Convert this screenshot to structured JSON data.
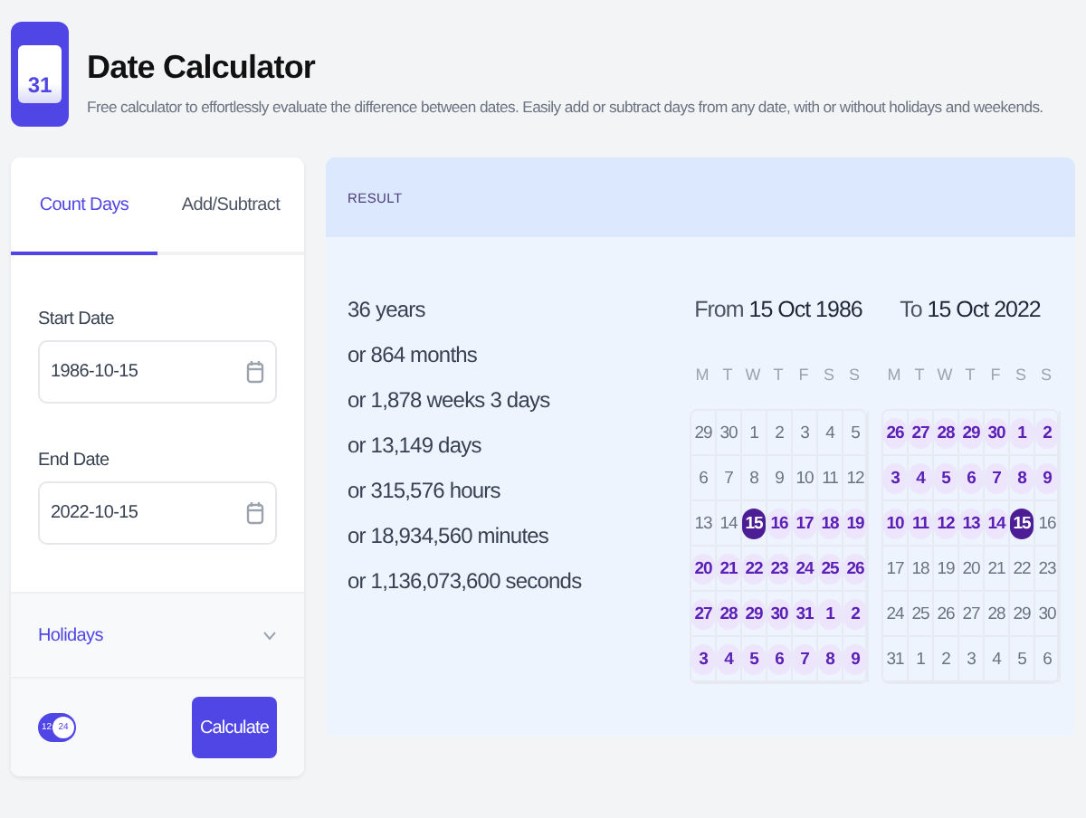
{
  "header": {
    "title": "Date Calculator",
    "subtitle": "Free calculator to effortlessly evaluate the difference between dates. Easily add or subtract days from any date, with or without holidays and weekends.",
    "icon_text": "31"
  },
  "form": {
    "tabs": [
      {
        "label": "Count Days",
        "selected": true
      },
      {
        "label": "Add/Subtract",
        "selected": false
      }
    ],
    "fields": [
      {
        "label": "Start Date",
        "value": "1986-10-15"
      },
      {
        "label": "End Date",
        "value": "2022-10-15"
      }
    ],
    "holidays": {
      "label": "Holidays",
      "expanded": false
    },
    "clock_toggle": {
      "labels": [
        "12",
        "24"
      ],
      "on": true
    },
    "button": "Calculate"
  },
  "result": {
    "heading": "RESULT",
    "lines": [
      "36 years",
      "or 864 months",
      "or 1,878 weeks 3 days",
      "or 13,149 days",
      "or 315,576 hours",
      "or 18,934,560 minutes",
      "or 1,136,073,600 seconds"
    ],
    "calendars": [
      {
        "prefix": "From",
        "date": "15 Oct 1986",
        "weekdays": [
          "M",
          "T",
          "W",
          "T",
          "F",
          "S",
          "S"
        ],
        "weeks": [
          [
            {
              "day": "29",
              "kind": "out"
            },
            {
              "day": "30",
              "kind": "out"
            },
            {
              "day": "1",
              "kind": "out"
            },
            {
              "day": "2",
              "kind": "out"
            },
            {
              "day": "3",
              "kind": "out"
            },
            {
              "day": "4",
              "kind": "out"
            },
            {
              "day": "5",
              "kind": "out"
            }
          ],
          [
            {
              "day": "6",
              "kind": "out"
            },
            {
              "day": "7",
              "kind": "out"
            },
            {
              "day": "8",
              "kind": "out"
            },
            {
              "day": "9",
              "kind": "out"
            },
            {
              "day": "10",
              "kind": "out"
            },
            {
              "day": "11",
              "kind": "out"
            },
            {
              "day": "12",
              "kind": "out"
            }
          ],
          [
            {
              "day": "13",
              "kind": "out"
            },
            {
              "day": "14",
              "kind": "out"
            },
            {
              "day": "15",
              "kind": "end"
            },
            {
              "day": "16",
              "kind": "range"
            },
            {
              "day": "17",
              "kind": "range"
            },
            {
              "day": "18",
              "kind": "range"
            },
            {
              "day": "19",
              "kind": "range"
            }
          ],
          [
            {
              "day": "20",
              "kind": "range"
            },
            {
              "day": "21",
              "kind": "range"
            },
            {
              "day": "22",
              "kind": "range"
            },
            {
              "day": "23",
              "kind": "range"
            },
            {
              "day": "24",
              "kind": "range"
            },
            {
              "day": "25",
              "kind": "range"
            },
            {
              "day": "26",
              "kind": "range"
            }
          ],
          [
            {
              "day": "27",
              "kind": "range"
            },
            {
              "day": "28",
              "kind": "range"
            },
            {
              "day": "29",
              "kind": "range"
            },
            {
              "day": "30",
              "kind": "range"
            },
            {
              "day": "31",
              "kind": "range"
            },
            {
              "day": "1",
              "kind": "range"
            },
            {
              "day": "2",
              "kind": "range"
            }
          ],
          [
            {
              "day": "3",
              "kind": "range"
            },
            {
              "day": "4",
              "kind": "range"
            },
            {
              "day": "5",
              "kind": "range"
            },
            {
              "day": "6",
              "kind": "range"
            },
            {
              "day": "7",
              "kind": "range"
            },
            {
              "day": "8",
              "kind": "range"
            },
            {
              "day": "9",
              "kind": "range"
            }
          ]
        ]
      },
      {
        "prefix": "To",
        "date": "15 Oct 2022",
        "weekdays": [
          "M",
          "T",
          "W",
          "T",
          "F",
          "S",
          "S"
        ],
        "weeks": [
          [
            {
              "day": "26",
              "kind": "range"
            },
            {
              "day": "27",
              "kind": "range"
            },
            {
              "day": "28",
              "kind": "range"
            },
            {
              "day": "29",
              "kind": "range"
            },
            {
              "day": "30",
              "kind": "range"
            },
            {
              "day": "1",
              "kind": "range"
            },
            {
              "day": "2",
              "kind": "range"
            }
          ],
          [
            {
              "day": "3",
              "kind": "range"
            },
            {
              "day": "4",
              "kind": "range"
            },
            {
              "day": "5",
              "kind": "range"
            },
            {
              "day": "6",
              "kind": "range"
            },
            {
              "day": "7",
              "kind": "range"
            },
            {
              "day": "8",
              "kind": "range"
            },
            {
              "day": "9",
              "kind": "range"
            }
          ],
          [
            {
              "day": "10",
              "kind": "range"
            },
            {
              "day": "11",
              "kind": "range"
            },
            {
              "day": "12",
              "kind": "range"
            },
            {
              "day": "13",
              "kind": "range"
            },
            {
              "day": "14",
              "kind": "range"
            },
            {
              "day": "15",
              "kind": "end"
            },
            {
              "day": "16",
              "kind": "out"
            }
          ],
          [
            {
              "day": "17",
              "kind": "out"
            },
            {
              "day": "18",
              "kind": "out"
            },
            {
              "day": "19",
              "kind": "out"
            },
            {
              "day": "20",
              "kind": "out"
            },
            {
              "day": "21",
              "kind": "out"
            },
            {
              "day": "22",
              "kind": "out"
            },
            {
              "day": "23",
              "kind": "out"
            }
          ],
          [
            {
              "day": "24",
              "kind": "out"
            },
            {
              "day": "25",
              "kind": "out"
            },
            {
              "day": "26",
              "kind": "out"
            },
            {
              "day": "27",
              "kind": "out"
            },
            {
              "day": "28",
              "kind": "out"
            },
            {
              "day": "29",
              "kind": "out"
            },
            {
              "day": "30",
              "kind": "out"
            }
          ],
          [
            {
              "day": "31",
              "kind": "out"
            },
            {
              "day": "1",
              "kind": "out"
            },
            {
              "day": "2",
              "kind": "out"
            },
            {
              "day": "3",
              "kind": "out"
            },
            {
              "day": "4",
              "kind": "out"
            },
            {
              "day": "5",
              "kind": "out"
            },
            {
              "day": "6",
              "kind": "out"
            }
          ]
        ]
      }
    ]
  }
}
